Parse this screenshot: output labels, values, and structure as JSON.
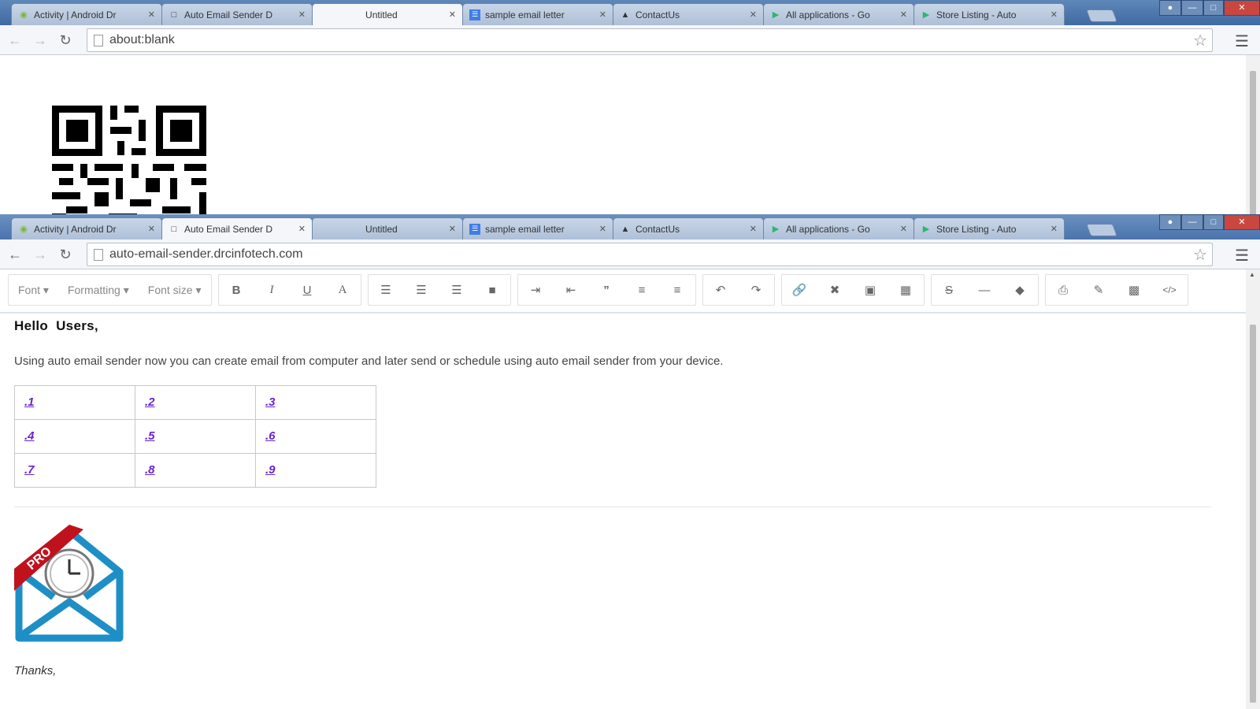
{
  "tabs": [
    {
      "title": "Activity | Android Dr",
      "icon": "android-icon"
    },
    {
      "title": "Auto Email Sender D",
      "icon": "page-icon"
    },
    {
      "title": "Untitled",
      "icon": ""
    },
    {
      "title": "sample email letter",
      "icon": "google-docs-icon"
    },
    {
      "title": "ContactUs",
      "icon": "contact-icon"
    },
    {
      "title": "All applications - Go",
      "icon": "play-store-icon"
    },
    {
      "title": "Store Listing - Auto",
      "icon": "play-store-icon"
    }
  ],
  "window1": {
    "url": "about:blank",
    "active_tab": 2
  },
  "window2": {
    "url": "auto-email-sender.drcinfotech.com",
    "active_tab": 1
  },
  "editor": {
    "dropdowns": [
      "Font",
      "Formatting",
      "Font size"
    ],
    "format_buttons": [
      "B",
      "I",
      "U",
      "A"
    ]
  },
  "email": {
    "greeting": "Hello  Users,",
    "body": "Using auto email sender now you can create email from computer and later send or schedule using auto email sender from your device.",
    "grid": [
      [
        ".1",
        ".2",
        ".3"
      ],
      [
        ".4",
        ".5",
        ".6"
      ],
      [
        ".7",
        ".8",
        ".9"
      ]
    ],
    "logo_badge": "PRO",
    "signoff": "Thanks,"
  },
  "colors": {
    "link": "#6a24d0",
    "logo_blue": "#1e8fc6",
    "ribbon_red": "#c0121d",
    "titlebar": "#4a74ad"
  }
}
